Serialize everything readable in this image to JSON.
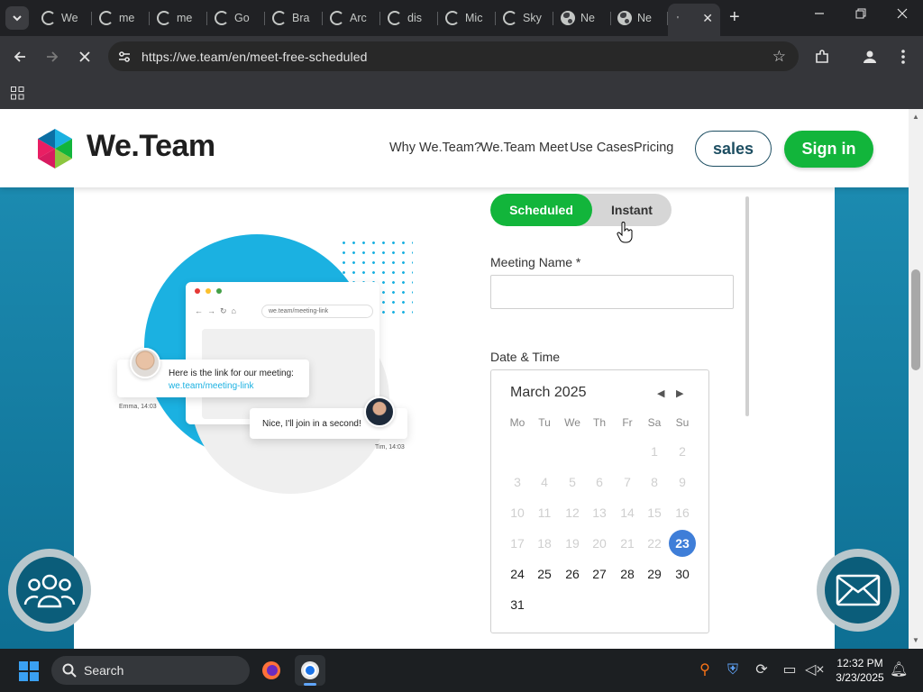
{
  "browser": {
    "tabs": [
      {
        "title": "We",
        "icon": "c-logo-icon"
      },
      {
        "title": "me",
        "icon": "c-logo-icon"
      },
      {
        "title": "me",
        "icon": "c-logo-icon"
      },
      {
        "title": "Go",
        "icon": "c-logo-icon"
      },
      {
        "title": "Bra",
        "icon": "c-logo-icon"
      },
      {
        "title": "Arc",
        "icon": "c-logo-icon"
      },
      {
        "title": "dis",
        "icon": "c-logo-icon"
      },
      {
        "title": "Mic",
        "icon": "c-logo-icon"
      },
      {
        "title": "Sky",
        "icon": "c-logo-icon"
      },
      {
        "title": "Ne",
        "icon": "globe-icon"
      },
      {
        "title": "Ne",
        "icon": "globe-icon"
      }
    ],
    "active_tab": {
      "title": "",
      "close": "✕"
    },
    "new_tab": "+",
    "url": "https://we.team/en/meet-free-scheduled"
  },
  "site": {
    "brand": "We.Team",
    "nav": [
      "Why We.Team?",
      "We.Team Meet",
      "Use Cases",
      "Pricing"
    ],
    "sales_label": "sales",
    "signin_label": "Sign in",
    "accent_green": "#12b53b",
    "accent_blue": "#1a87ad"
  },
  "illustration": {
    "url_bar": "we.team/meeting-link",
    "message1": "Here is the link for our meeting:",
    "message1_link": "we.team/meeting-link",
    "sender1": "Emma, 14:03",
    "message2": "Nice, I'll join in a second!",
    "sender2": "Tim, 14:03"
  },
  "form": {
    "mode_scheduled": "Scheduled",
    "mode_instant": "Instant",
    "active_mode": "Scheduled",
    "meeting_name_label": "Meeting Name *",
    "meeting_name_value": "",
    "date_time_label": "Date & Time",
    "calendar": {
      "month_title": "March 2025",
      "weekdays": [
        "Mo",
        "Tu",
        "We",
        "Th",
        "Fr",
        "Sa",
        "Su"
      ],
      "selected_day": 23,
      "weeks": [
        [
          "",
          "",
          "",
          "",
          "",
          "1",
          "2"
        ],
        [
          "3",
          "4",
          "5",
          "6",
          "7",
          "8",
          "9"
        ],
        [
          "10",
          "11",
          "12",
          "13",
          "14",
          "15",
          "16"
        ],
        [
          "17",
          "18",
          "19",
          "20",
          "21",
          "22",
          "23"
        ],
        [
          "24",
          "25",
          "26",
          "27",
          "28",
          "29",
          "30"
        ],
        [
          "31",
          "",
          "",
          "",
          "",
          "",
          ""
        ]
      ]
    }
  },
  "taskbar": {
    "search_label": "Search",
    "time": "12:32 PM",
    "date": "3/23/2025"
  }
}
